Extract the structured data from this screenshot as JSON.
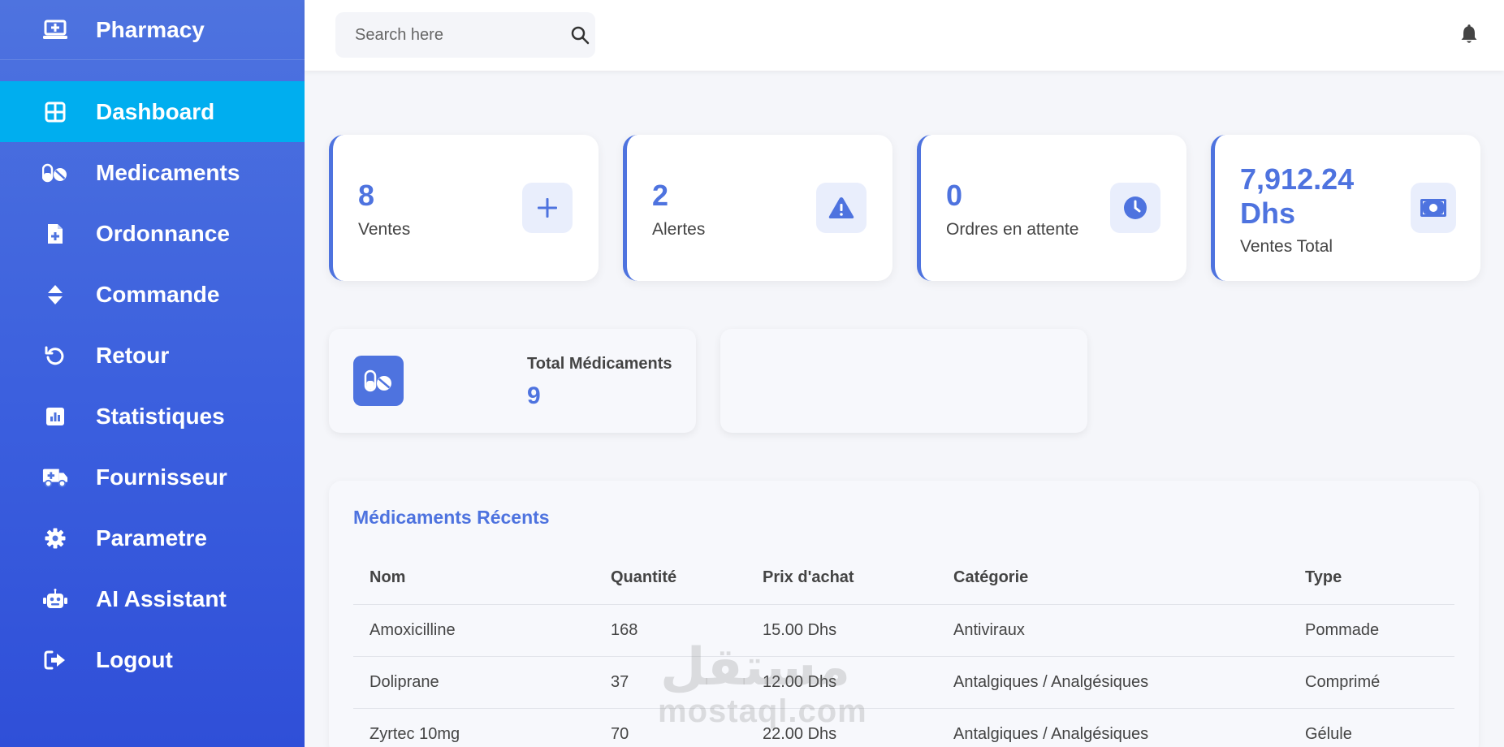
{
  "brand": {
    "name": "Pharmacy",
    "icon": "laptop-medical-icon"
  },
  "sidebar": {
    "items": [
      {
        "label": "Dashboard",
        "icon": "grid-icon",
        "active": true
      },
      {
        "label": "Medicaments",
        "icon": "pills-icon"
      },
      {
        "label": "Ordonnance",
        "icon": "file-medical-icon"
      },
      {
        "label": "Commande",
        "icon": "sort-icon"
      },
      {
        "label": "Retour",
        "icon": "undo-icon"
      },
      {
        "label": "Statistiques",
        "icon": "chart-bar-icon"
      },
      {
        "label": "Fournisseur",
        "icon": "ambulance-icon"
      },
      {
        "label": "Parametre",
        "icon": "gear-icon"
      },
      {
        "label": "AI Assistant",
        "icon": "robot-icon"
      },
      {
        "label": "Logout",
        "icon": "logout-icon"
      }
    ]
  },
  "search": {
    "placeholder": "Search here"
  },
  "stats": [
    {
      "value": "8",
      "label": "Ventes",
      "icon": "plus-icon"
    },
    {
      "value": "2",
      "label": "Alertes",
      "icon": "warning-icon"
    },
    {
      "value": "0",
      "label": "Ordres en attente",
      "icon": "clock-icon"
    },
    {
      "value": "7,912.24 Dhs",
      "label": "Ventes Total",
      "icon": "money-icon"
    }
  ],
  "total_meds": {
    "label": "Total Médicaments",
    "value": "9"
  },
  "recent": {
    "title": "Médicaments Récents",
    "headers": [
      "Nom",
      "Quantité",
      "Prix d'achat",
      "Catégorie",
      "Type"
    ],
    "rows": [
      [
        "Amoxicilline",
        "168",
        "15.00 Dhs",
        "Antiviraux",
        "Pommade"
      ],
      [
        "Doliprane",
        "37",
        "12.00 Dhs",
        "Antalgiques / Analgésiques",
        "Comprimé"
      ],
      [
        "Zyrtec 10mg",
        "70",
        "22.00 Dhs",
        "Antalgiques / Analgésiques",
        "Gélule"
      ]
    ]
  },
  "watermark": {
    "arabic": "مستقل",
    "latin": "mostaql.com"
  },
  "colors": {
    "primary": "#4e73df",
    "active": "#00aeef"
  }
}
